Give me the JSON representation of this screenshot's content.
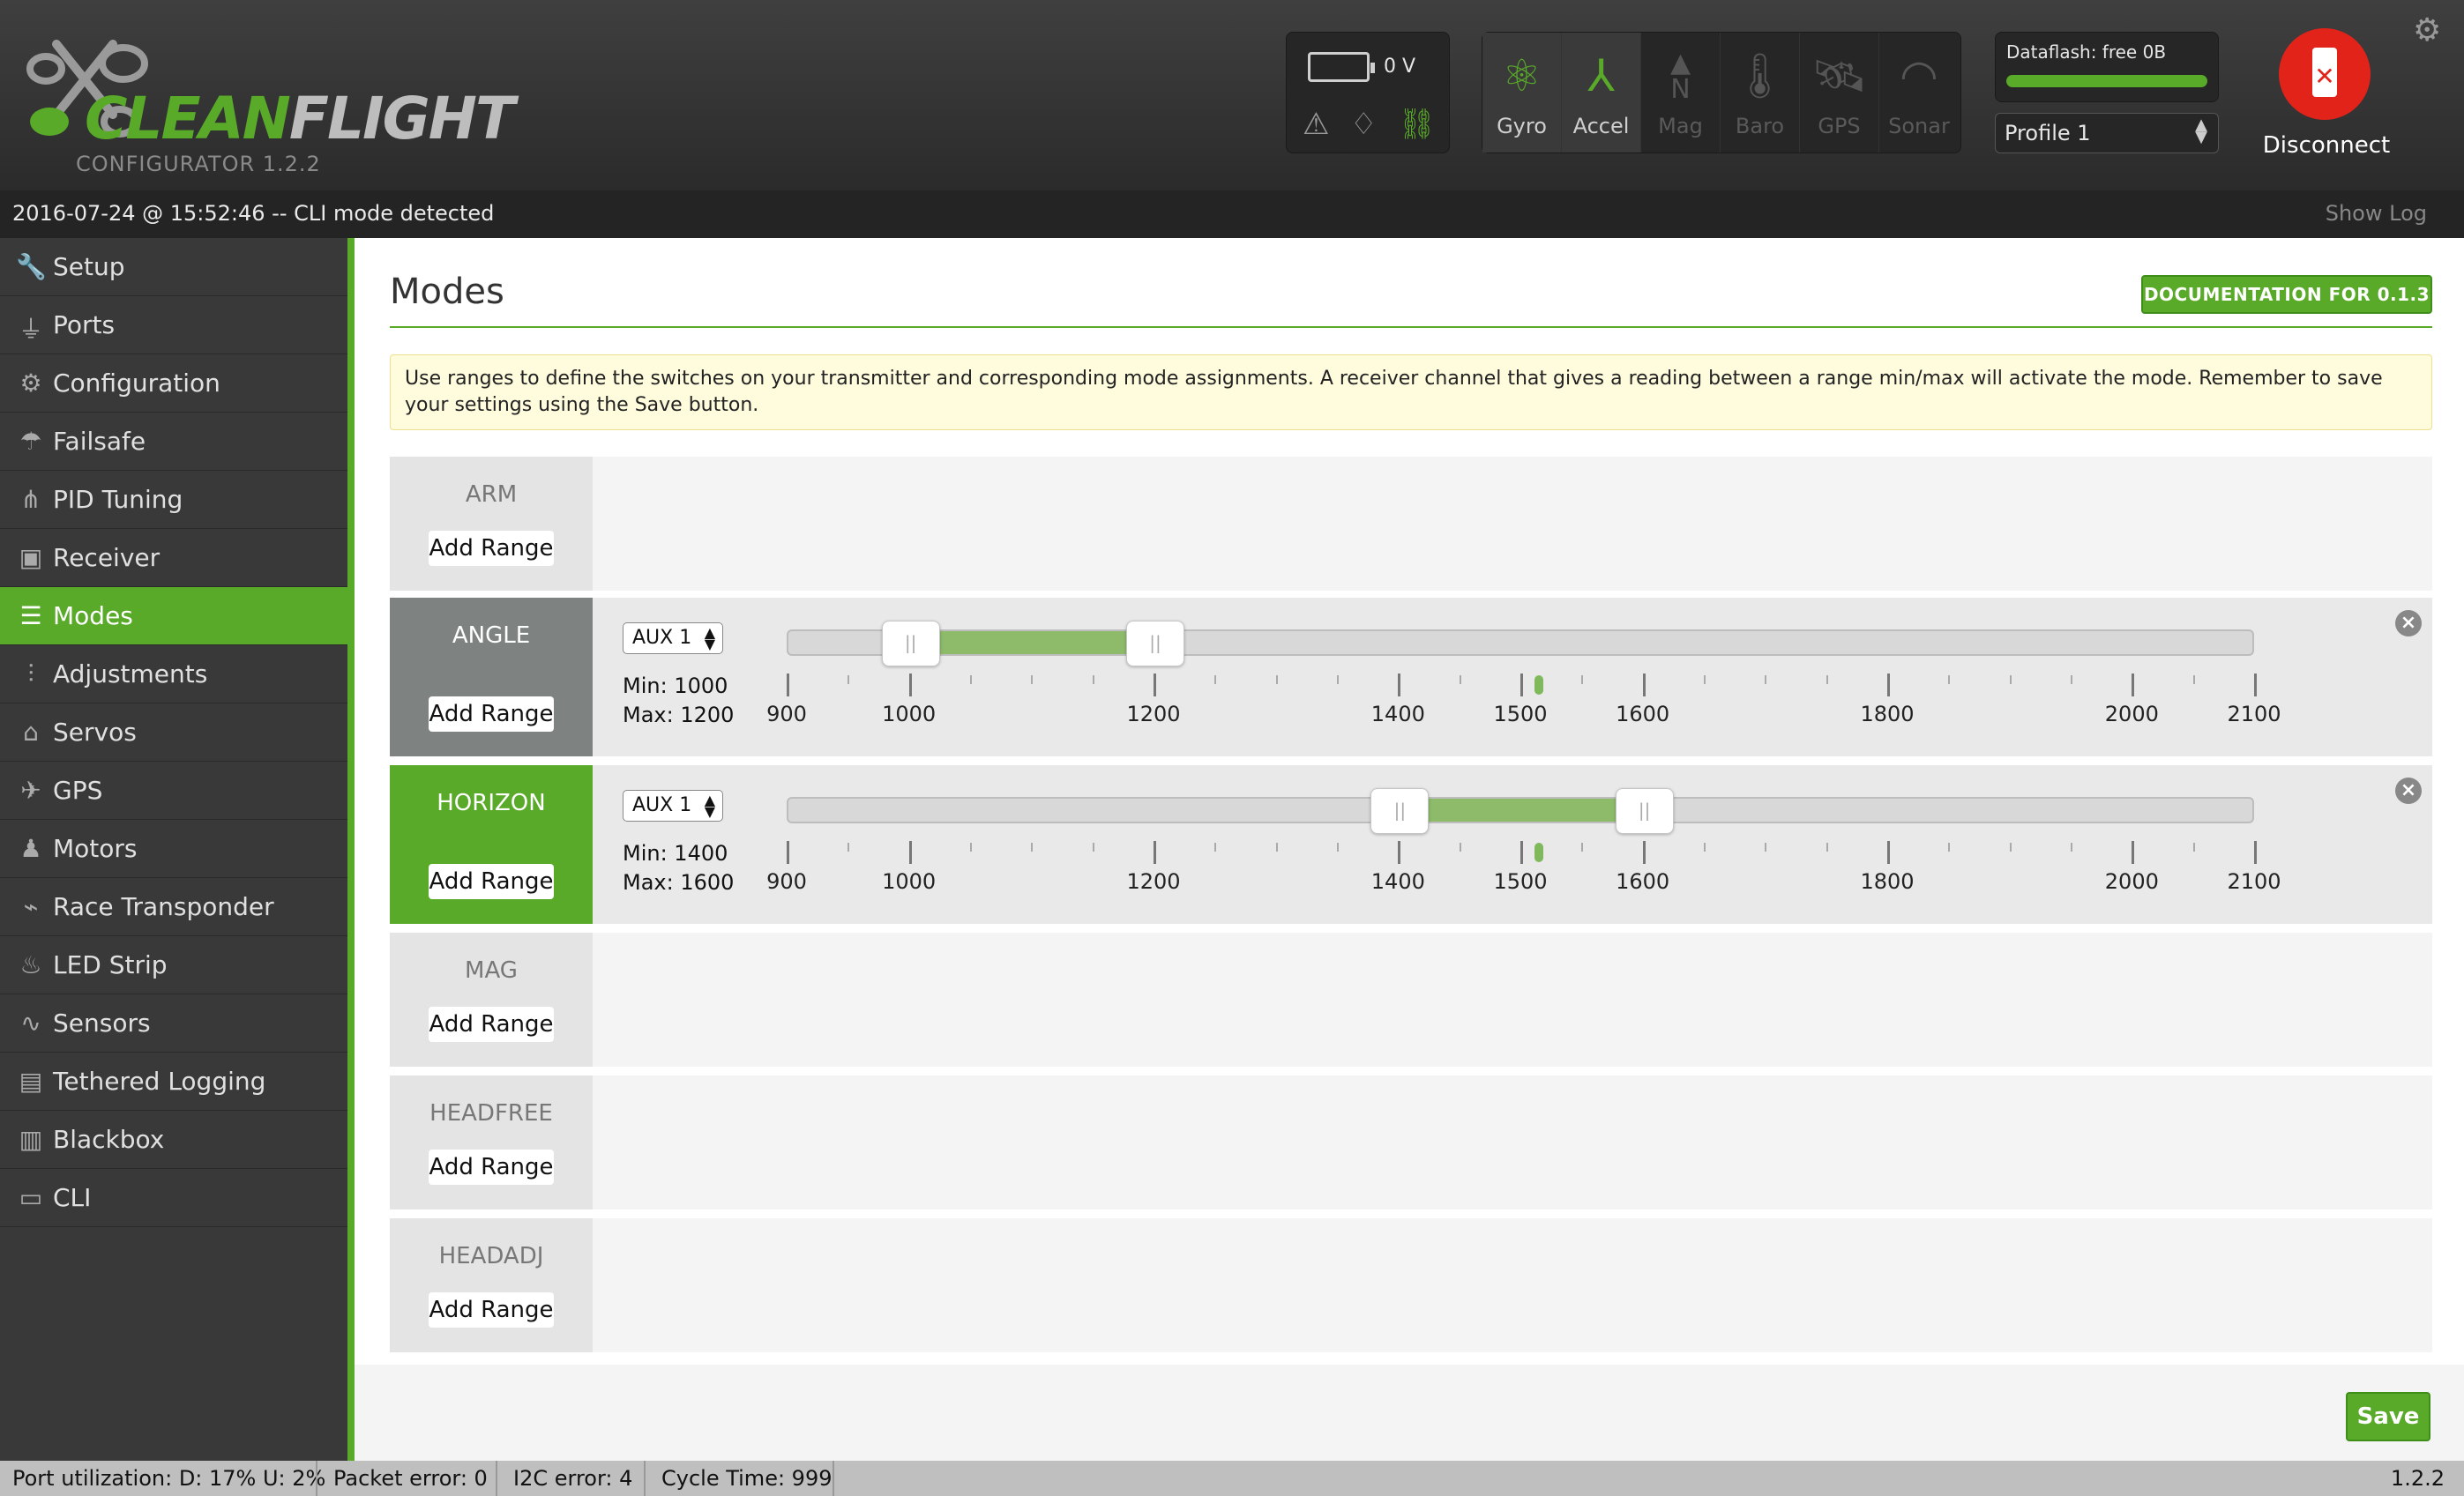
{
  "header": {
    "logo_clean": "CLEAN",
    "logo_flight": "FLIGHT",
    "logo_sub": "CONFIGURATOR  1.2.2",
    "battery_voltage": "0 V",
    "sensors": [
      {
        "label": "Gyro",
        "icon": "gyro-icon",
        "active": true
      },
      {
        "label": "Accel",
        "icon": "accel-icon",
        "active": true
      },
      {
        "label": "Mag",
        "icon": "mag-icon",
        "active": false
      },
      {
        "label": "Baro",
        "icon": "baro-icon",
        "active": false
      },
      {
        "label": "GPS",
        "icon": "gps-icon",
        "active": false
      },
      {
        "label": "Sonar",
        "icon": "sonar-icon",
        "active": false
      }
    ],
    "dataflash": "Dataflash: free 0B",
    "profile": "Profile 1",
    "disconnect": "Disconnect"
  },
  "log": {
    "message": "2016-07-24 @ 15:52:46 -- CLI mode detected",
    "show_log": "Show Log"
  },
  "sidebar": {
    "items": [
      {
        "label": "Setup",
        "icon": "wrench-icon"
      },
      {
        "label": "Ports",
        "icon": "plug-icon"
      },
      {
        "label": "Configuration",
        "icon": "gear-icon"
      },
      {
        "label": "Failsafe",
        "icon": "parachute-icon"
      },
      {
        "label": "PID Tuning",
        "icon": "sitemap-icon"
      },
      {
        "label": "Receiver",
        "icon": "remote-icon"
      },
      {
        "label": "Modes",
        "icon": "toggle-icon"
      },
      {
        "label": "Adjustments",
        "icon": "sliders-icon"
      },
      {
        "label": "Servos",
        "icon": "servo-icon"
      },
      {
        "label": "GPS",
        "icon": "satellite-icon"
      },
      {
        "label": "Motors",
        "icon": "motor-icon"
      },
      {
        "label": "Race Transponder",
        "icon": "transponder-icon"
      },
      {
        "label": "LED Strip",
        "icon": "led-icon"
      },
      {
        "label": "Sensors",
        "icon": "pulse-icon"
      },
      {
        "label": "Tethered Logging",
        "icon": "logging-icon"
      },
      {
        "label": "Blackbox",
        "icon": "blackbox-icon"
      },
      {
        "label": "CLI",
        "icon": "terminal-icon"
      }
    ],
    "active_index": 6
  },
  "main": {
    "title": "Modes",
    "doc_button": "DOCUMENTATION FOR 0.1.3",
    "note": "Use ranges to define the switches on your transmitter and corresponding mode assignments. A receiver channel that gives a reading between a range min/max will activate the mode. Remember to save your settings using the Save button.",
    "add_range": "Add Range",
    "scale_labels": [
      "900",
      "1000",
      "1200",
      "1400",
      "1500",
      "1600",
      "1800",
      "2000",
      "2100"
    ],
    "modes": [
      {
        "name": "ARM"
      },
      {
        "name": "ANGLE",
        "channel": "AUX 1",
        "min_label": "Min: 1000",
        "max_label": "Max: 1200",
        "min": 1000,
        "max": 1200,
        "current": 1515
      },
      {
        "name": "HORIZON",
        "channel": "AUX 1",
        "min_label": "Min: 1400",
        "max_label": "Max: 1600",
        "min": 1400,
        "max": 1600,
        "current": 1515
      },
      {
        "name": "MAG"
      },
      {
        "name": "HEADFREE"
      },
      {
        "name": "HEADADJ"
      }
    ],
    "save": "Save"
  },
  "status": {
    "port_util": "Port utilization: D: 17% U: 2%",
    "packet_error": "Packet error: 0",
    "i2c_error": "I2C error: 4",
    "cycle_time": "Cycle Time: 999",
    "version": "1.2.2"
  },
  "colors": {
    "accent": "#59aa29",
    "range_fill": "#8dbb6a",
    "disconnect": "#e2231a"
  }
}
